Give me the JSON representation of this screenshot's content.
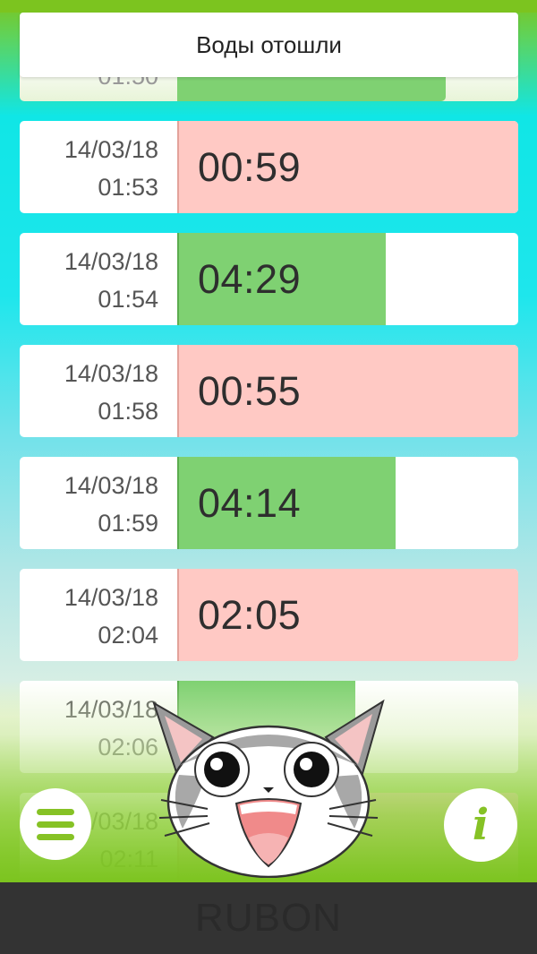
{
  "header": {
    "title": "Воды отошли"
  },
  "partial_top": {
    "time": "01:50"
  },
  "rows": [
    {
      "date": "14/03/18",
      "time": "01:53",
      "duration": "00:59",
      "kind": "red"
    },
    {
      "date": "14/03/18",
      "time": "01:54",
      "duration": "04:29",
      "kind": "green"
    },
    {
      "date": "14/03/18",
      "time": "01:58",
      "duration": "00:55",
      "kind": "red"
    },
    {
      "date": "14/03/18",
      "time": "01:59",
      "duration": "04:14",
      "kind": "green"
    },
    {
      "date": "14/03/18",
      "time": "02:04",
      "duration": "02:05",
      "kind": "red"
    },
    {
      "date": "14/03/18",
      "time": "02:06",
      "duration": "",
      "kind": "green"
    },
    {
      "date": "14/03/18",
      "time": "02:11",
      "duration": "",
      "kind": "red"
    }
  ],
  "buttons": {
    "menu_icon": "hamburger-menu-icon",
    "info_label": "i"
  },
  "mascot": {
    "icon": "cat-mascot-icon"
  },
  "footer": {
    "text": "RUBON"
  },
  "colors": {
    "green_bar": "#7fd172",
    "red_bar": "#ffc9c4",
    "accent": "#86c225",
    "footer_bg": "#333333"
  }
}
